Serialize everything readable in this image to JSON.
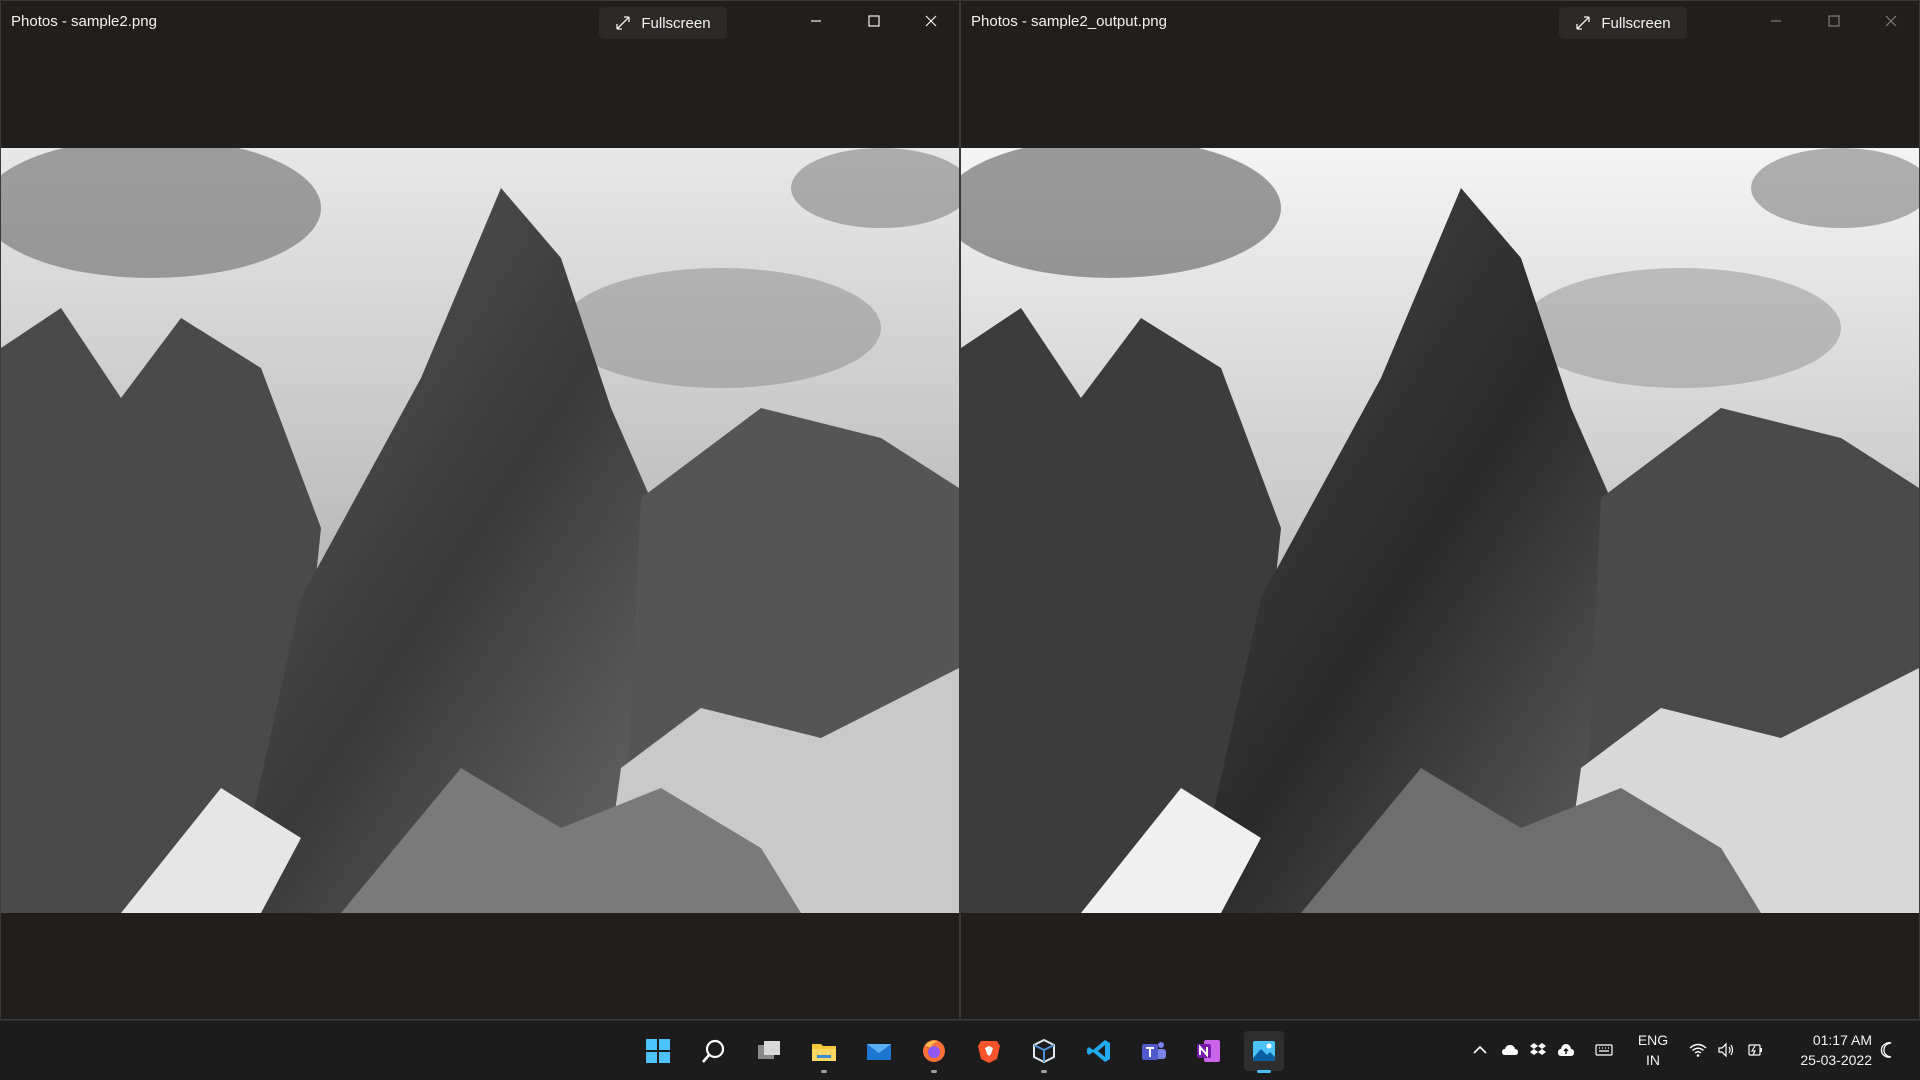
{
  "windows": [
    {
      "title": "Photos - sample2.png",
      "fullscreen_label": "Fullscreen",
      "image_label": "sample2.png"
    },
    {
      "title": "Photos - sample2_output.png",
      "fullscreen_label": "Fullscreen",
      "image_label": "sample2_output.png"
    }
  ],
  "taskbar": {
    "apps": [
      {
        "name": "Start",
        "icon": "windows-logo-icon"
      },
      {
        "name": "Search",
        "icon": "search-icon"
      },
      {
        "name": "Task View",
        "icon": "task-view-icon"
      },
      {
        "name": "File Explorer",
        "icon": "folder-icon"
      },
      {
        "name": "Mail",
        "icon": "mail-icon"
      },
      {
        "name": "Firefox",
        "icon": "firefox-icon"
      },
      {
        "name": "Brave",
        "icon": "brave-icon"
      },
      {
        "name": "VirtualBox",
        "icon": "cube-icon"
      },
      {
        "name": "Visual Studio Code",
        "icon": "vscode-icon"
      },
      {
        "name": "Teams",
        "icon": "teams-icon"
      },
      {
        "name": "OneNote",
        "icon": "onenote-icon"
      },
      {
        "name": "Photos",
        "icon": "photos-icon"
      }
    ],
    "tray": {
      "language_line1": "ENG",
      "language_line2": "IN",
      "time": "01:17 AM",
      "date": "25-03-2022"
    }
  },
  "colors": {
    "accent": "#4cc2ff",
    "window_bg": "#201f1e",
    "taskbar_bg": "#1c1c1c"
  }
}
